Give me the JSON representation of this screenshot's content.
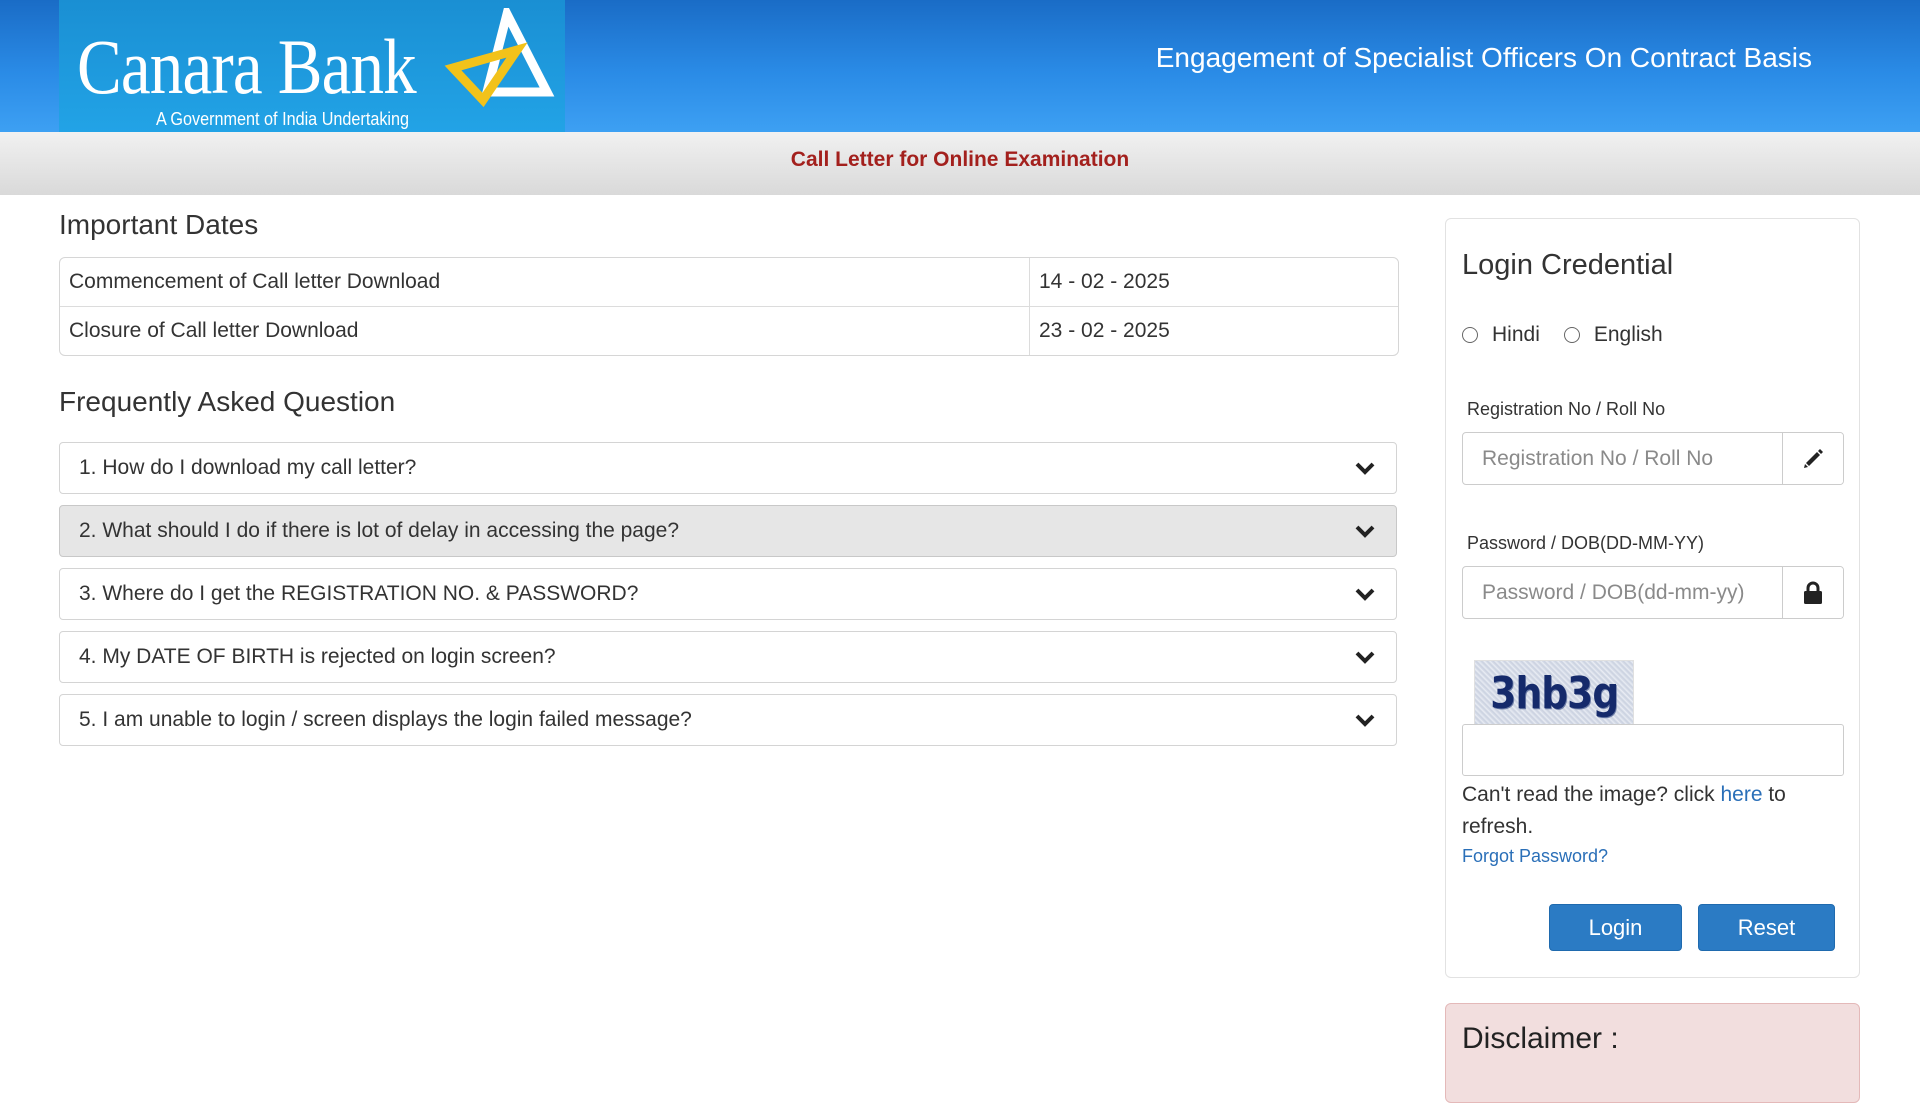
{
  "header": {
    "logo_name": "Canara Bank",
    "logo_tagline": "A Government of India Undertaking",
    "title": "Engagement of Specialist Officers On Contract Basis",
    "brand_color": "#1f7fd8"
  },
  "subbar": {
    "title": "Call Letter for Online Examination",
    "title_color": "#a3201d"
  },
  "important_dates": {
    "heading": "Important Dates",
    "rows": [
      {
        "label": "Commencement of Call letter Download",
        "value": "14 - 02 - 2025"
      },
      {
        "label": "Closure of Call letter Download",
        "value": "23 - 02 - 2025"
      }
    ]
  },
  "faq": {
    "heading": "Frequently Asked Question",
    "items": [
      {
        "text": "1. How do I download my call letter?",
        "icon": "chevron-down-icon"
      },
      {
        "text": "2. What should I do if there is lot of delay in accessing the page?",
        "icon": "chevron-down-icon"
      },
      {
        "text": "3. Where do I get the REGISTRATION NO. & PASSWORD?",
        "icon": "chevron-down-icon"
      },
      {
        "text": "4. My DATE OF BIRTH is rejected on login screen?",
        "icon": "chevron-down-icon"
      },
      {
        "text": "5. I am unable to login / screen displays the login failed message?",
        "icon": "chevron-down-icon"
      }
    ]
  },
  "login": {
    "title": "Login Credential",
    "language_options": [
      "Hindi",
      "English"
    ],
    "registration": {
      "label": "Registration No / Roll No",
      "placeholder": "Registration No / Roll No",
      "value": "",
      "icon": "pencil-icon"
    },
    "password": {
      "label": "Password / DOB(DD-MM-YY)",
      "placeholder": "Password / DOB(dd-mm-yy)",
      "value": "",
      "icon": "lock-icon"
    },
    "captcha": {
      "text": "3hb3g",
      "input_value": "",
      "help_prefix": "Can't read the image? click ",
      "help_link": "here",
      "help_suffix": " to refresh."
    },
    "forgot_password": "Forgot Password?",
    "login_button": "Login",
    "reset_button": "Reset",
    "button_color": "#2b7bc4"
  },
  "disclaimer": {
    "title": "Disclaimer :"
  }
}
